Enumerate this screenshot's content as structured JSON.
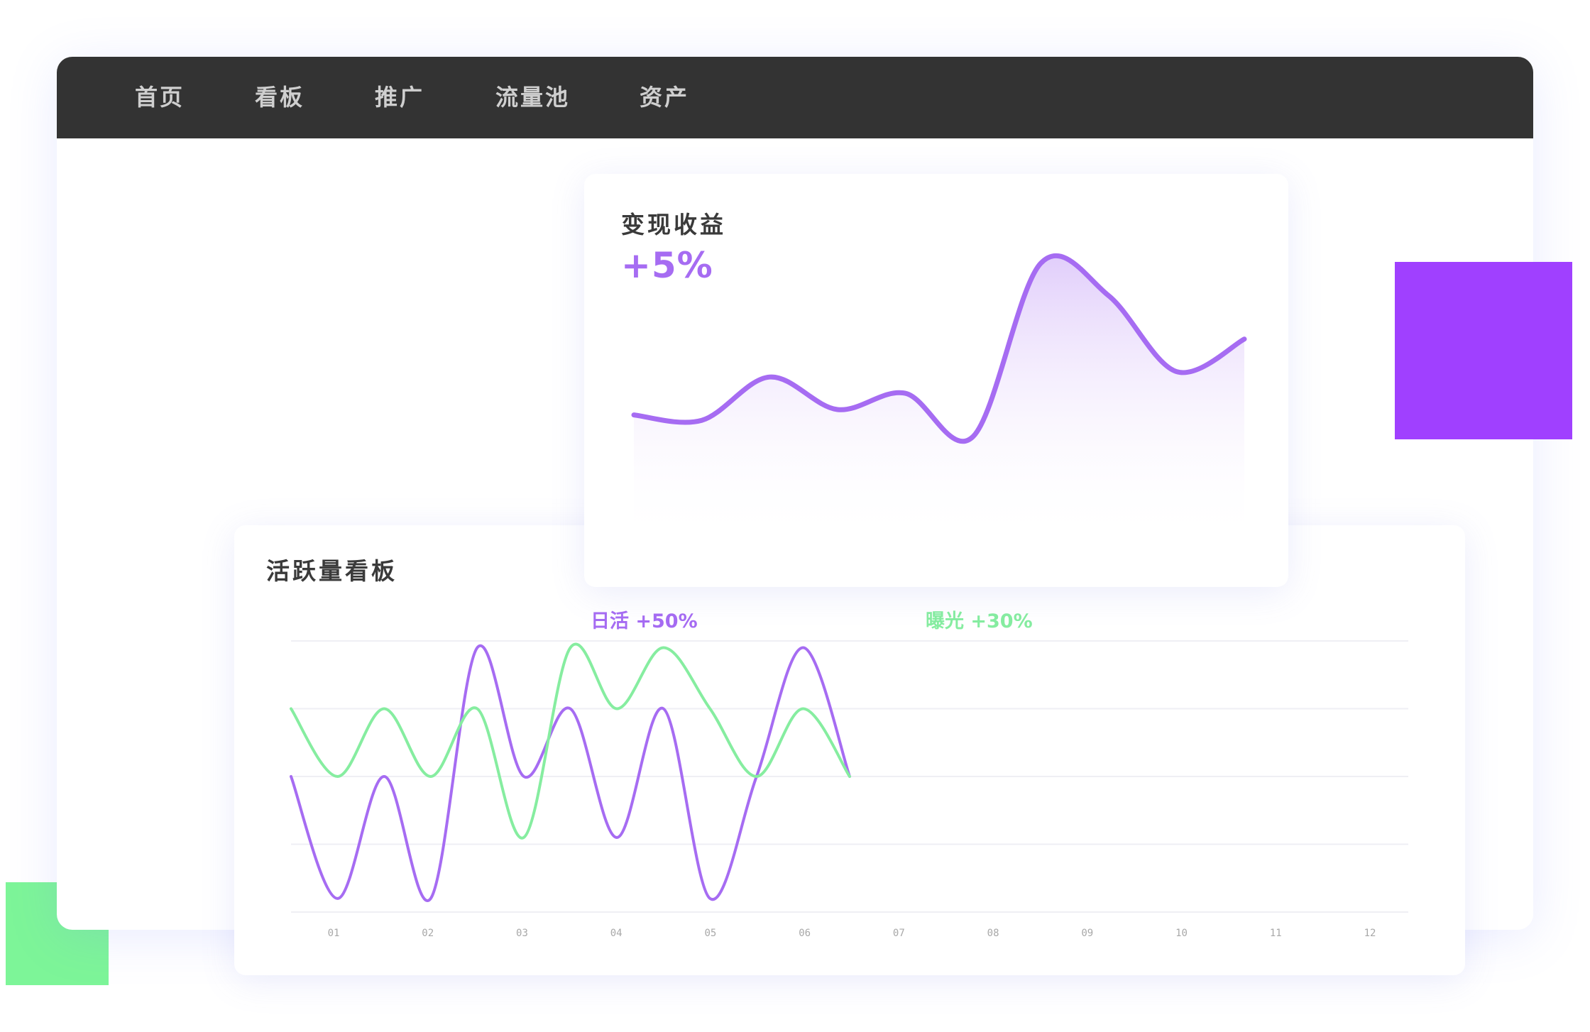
{
  "nav": {
    "items": [
      {
        "label": "首页"
      },
      {
        "label": "看板"
      },
      {
        "label": "推广"
      },
      {
        "label": "流量池"
      },
      {
        "label": "资产"
      }
    ]
  },
  "revenue_card": {
    "title": "变现收益",
    "change": "+5%"
  },
  "activity_card": {
    "title": "活跃量看板",
    "legend_daily": "日活 +50%",
    "legend_exposure": "曝光 +30%"
  },
  "colors": {
    "purple": "#a66cf2",
    "green": "#86eda0",
    "nav_bg": "#333333",
    "deco_purple": "#a040ff",
    "deco_green": "#7df598"
  },
  "chart_data": [
    {
      "type": "area",
      "title": "变现收益",
      "x": [
        0,
        1,
        2,
        3,
        4,
        5,
        6,
        7,
        8,
        9
      ],
      "series": [
        {
          "values": [
            42,
            40,
            56,
            44,
            50,
            34,
            98,
            86,
            58,
            70
          ]
        }
      ],
      "ylim": [
        0,
        110
      ],
      "grid": false
    },
    {
      "type": "line",
      "categories": [
        "01",
        "02",
        "03",
        "04",
        "05",
        "06",
        "07",
        "08",
        "09",
        "10",
        "11",
        "12"
      ],
      "ylim": [
        0,
        4
      ],
      "grid": true,
      "x": [
        0,
        0.5,
        1,
        1.5,
        2,
        2.5,
        3,
        3.5,
        4,
        4.5,
        5,
        5.5,
        6,
        6.5,
        7,
        7.5,
        8,
        8.5,
        9,
        9.5,
        10,
        10.5,
        11,
        11.5,
        12
      ],
      "series": [
        {
          "name": "日活",
          "values": [
            2,
            0.2,
            2,
            0.2,
            3.9,
            2,
            3,
            1.1,
            3,
            0.2,
            2,
            3.9,
            2
          ]
        },
        {
          "name": "曝光",
          "values": [
            3,
            2,
            3,
            2,
            3,
            1.1,
            3.9,
            3,
            3.9,
            3,
            2,
            3,
            2
          ]
        }
      ]
    }
  ]
}
